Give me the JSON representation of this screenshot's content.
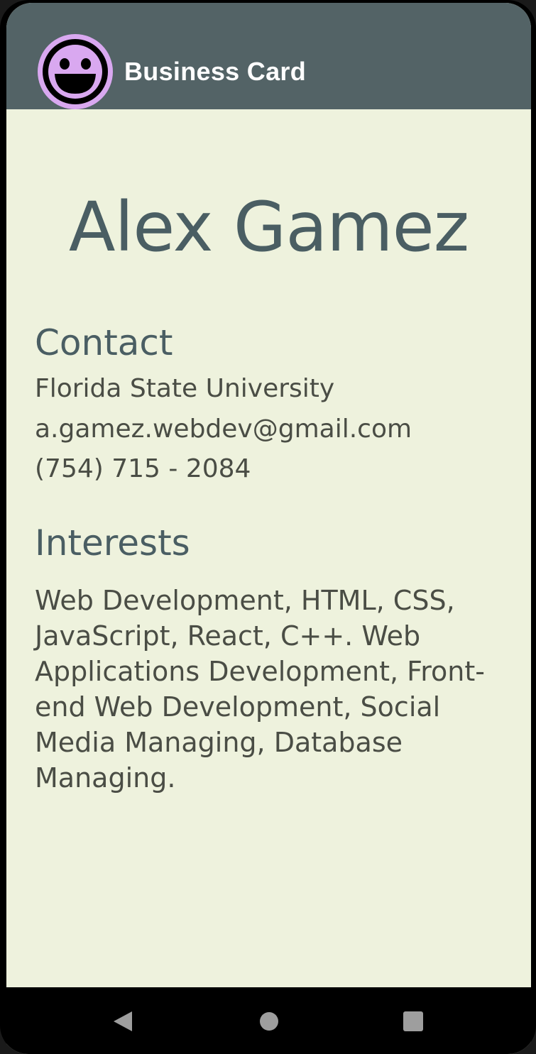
{
  "app_bar": {
    "title": "Business Card",
    "logo_icon": "smiley-face-icon",
    "background_color": "#536366",
    "logo_color": "#d9a8f0"
  },
  "card": {
    "name": "Alex Gamez",
    "contact": {
      "heading": "Contact",
      "lines": [
        "Florida State University",
        "a.gamez.webdev@gmail.com",
        "(754) 715 - 2084"
      ]
    },
    "interests": {
      "heading": "Interests",
      "text": "Web Development, HTML, CSS, JavaScript, React, C++. Web Applications Development, Front-end Web Development, Social Media Managing, Database Managing."
    },
    "background_color": "#eef2dd",
    "accent_color": "#4a5e63"
  },
  "nav_bar": {
    "back_icon": "back-triangle-icon",
    "home_icon": "home-circle-icon",
    "recents_icon": "recents-square-icon"
  }
}
